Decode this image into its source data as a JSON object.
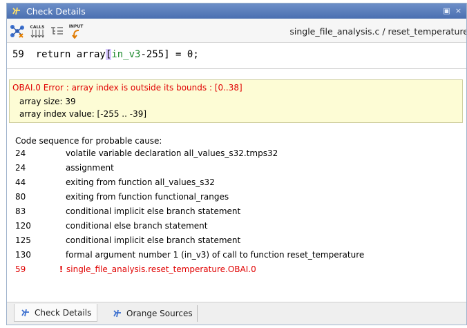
{
  "window": {
    "title": "Check Details",
    "title_icon": "check-details-icon"
  },
  "toolbar": {
    "calls_label": "CALLS",
    "input_label": "INPUT",
    "file_path": "single_file_analysis.c / reset_temperature"
  },
  "code": {
    "line_number": "59",
    "pre": "return array",
    "bracket_open": "[",
    "var": "in_v3",
    "post": "-255",
    "bracket_close": "]",
    "rest": " = 0;"
  },
  "error": {
    "message": "OBAI.0 Error : array index is outside its bounds : [0..38]",
    "array_size": "array size: 39",
    "array_index": "array index value: [-255 .. -39]"
  },
  "sequence": {
    "title": "Code sequence for probable cause:",
    "rows": [
      {
        "line": "24",
        "text": "volatile variable declaration all_values_s32.tmps32"
      },
      {
        "line": "24",
        "text": "assignment"
      },
      {
        "line": "44",
        "text": "exiting from function all_values_s32"
      },
      {
        "line": "80",
        "text": "exiting from function functional_ranges"
      },
      {
        "line": "83",
        "text": "conditional implicit else branch statement"
      },
      {
        "line": "120",
        "text": "conditional else branch statement"
      },
      {
        "line": "125",
        "text": "conditional implicit else branch statement"
      },
      {
        "line": "130",
        "text": "formal argument number 1 (in_v3) of call to function reset_temperature"
      },
      {
        "line": "59",
        "text": "single_file_analysis.reset_temperature.OBAI.0",
        "error": true
      }
    ]
  },
  "tabs": [
    {
      "label": "Check Details",
      "active": true
    },
    {
      "label": "Orange Sources",
      "active": false
    }
  ],
  "colors": {
    "title_bar": "#5a7fbf",
    "error_text": "#e00000",
    "error_box": "#fdfcd5",
    "code_var": "#1e8a2e"
  }
}
